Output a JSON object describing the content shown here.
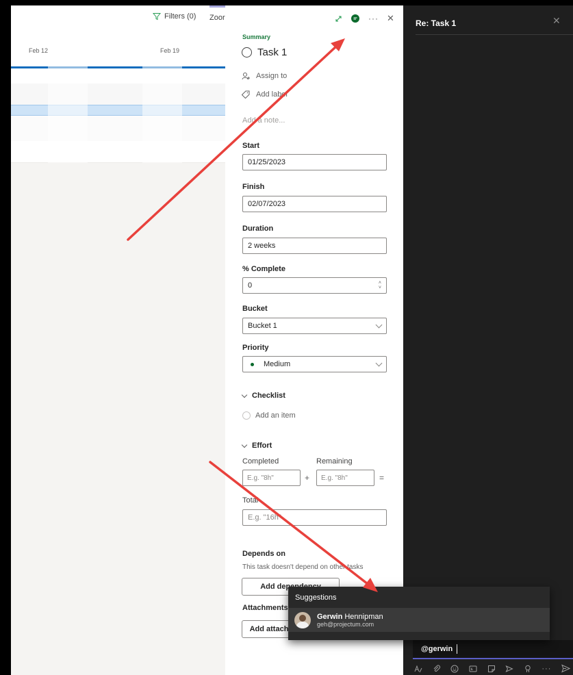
{
  "timeline": {
    "filters_label": "Filters (0)",
    "zoom_label": "Zoor",
    "dates": [
      "Feb 12",
      "Feb 19"
    ]
  },
  "panel": {
    "summary_label": "Summary",
    "task_title": "Task 1",
    "assign_label": "Assign to",
    "add_label": "Add label",
    "note_placeholder": "Add a note...",
    "start": {
      "label": "Start",
      "value": "01/25/2023"
    },
    "finish": {
      "label": "Finish",
      "value": "02/07/2023"
    },
    "duration": {
      "label": "Duration",
      "value": "2 weeks"
    },
    "percent_complete": {
      "label": "% Complete",
      "value": "0"
    },
    "bucket": {
      "label": "Bucket",
      "value": "Bucket 1"
    },
    "priority": {
      "label": "Priority",
      "value": "Medium"
    },
    "checklist": {
      "label": "Checklist",
      "add_item": "Add an item"
    },
    "effort": {
      "label": "Effort",
      "completed_label": "Completed",
      "remaining_label": "Remaining",
      "completed_placeholder": "E.g. \"8h\"",
      "remaining_placeholder": "E.g. \"8h\"",
      "plus": "+",
      "equals": "=",
      "total_label": "Total",
      "total_placeholder": "E.g. \"16h\""
    },
    "depends": {
      "label": "Depends on",
      "text": "This task doesn't depend on other tasks",
      "button": "Add dependency"
    },
    "attachments": {
      "label": "Attachments",
      "button": "Add attach"
    }
  },
  "chat": {
    "title": "Re: Task 1",
    "close_glyph": "✕",
    "compose_text": "@gerwin"
  },
  "suggestions": {
    "title": "Suggestions",
    "name_bold": "Gerwin",
    "name_rest": "Hennipman",
    "email": "geh@projectum.com"
  },
  "colors": {
    "accent": "#0f6cbd",
    "summary_green": "#1b7a3e",
    "arrow_red": "#e8413c",
    "chat_bg": "#1f1f1f"
  }
}
